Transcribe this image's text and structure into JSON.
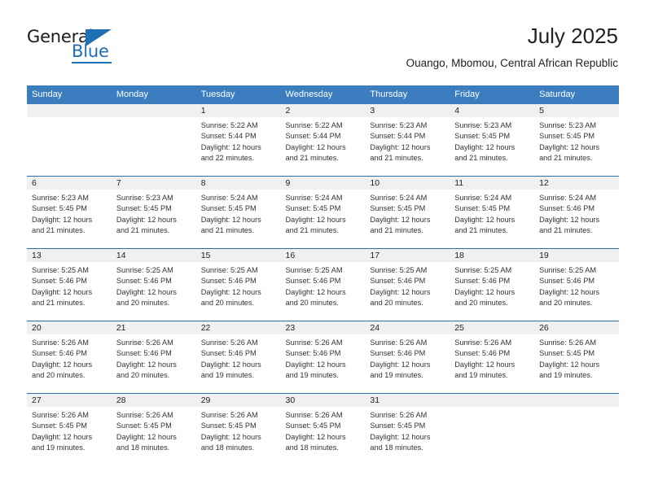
{
  "brand": {
    "name_part1": "General",
    "name_part2": "Blue",
    "accent_color": "#1f6fb5"
  },
  "header": {
    "month_title": "July 2025",
    "location": "Ouango, Mbomou, Central African Republic"
  },
  "calendar": {
    "header_bg": "#3b7dbf",
    "daynum_bg": "#f0f0f0",
    "row_divider": "#2f6ea5",
    "weekday_headers": [
      "Sunday",
      "Monday",
      "Tuesday",
      "Wednesday",
      "Thursday",
      "Friday",
      "Saturday"
    ],
    "weeks": [
      [
        {
          "day": "",
          "sunrise": "",
          "sunset": "",
          "daylight1": "",
          "daylight2": ""
        },
        {
          "day": "",
          "sunrise": "",
          "sunset": "",
          "daylight1": "",
          "daylight2": ""
        },
        {
          "day": "1",
          "sunrise": "Sunrise: 5:22 AM",
          "sunset": "Sunset: 5:44 PM",
          "daylight1": "Daylight: 12 hours",
          "daylight2": "and 22 minutes."
        },
        {
          "day": "2",
          "sunrise": "Sunrise: 5:22 AM",
          "sunset": "Sunset: 5:44 PM",
          "daylight1": "Daylight: 12 hours",
          "daylight2": "and 21 minutes."
        },
        {
          "day": "3",
          "sunrise": "Sunrise: 5:23 AM",
          "sunset": "Sunset: 5:44 PM",
          "daylight1": "Daylight: 12 hours",
          "daylight2": "and 21 minutes."
        },
        {
          "day": "4",
          "sunrise": "Sunrise: 5:23 AM",
          "sunset": "Sunset: 5:45 PM",
          "daylight1": "Daylight: 12 hours",
          "daylight2": "and 21 minutes."
        },
        {
          "day": "5",
          "sunrise": "Sunrise: 5:23 AM",
          "sunset": "Sunset: 5:45 PM",
          "daylight1": "Daylight: 12 hours",
          "daylight2": "and 21 minutes."
        }
      ],
      [
        {
          "day": "6",
          "sunrise": "Sunrise: 5:23 AM",
          "sunset": "Sunset: 5:45 PM",
          "daylight1": "Daylight: 12 hours",
          "daylight2": "and 21 minutes."
        },
        {
          "day": "7",
          "sunrise": "Sunrise: 5:23 AM",
          "sunset": "Sunset: 5:45 PM",
          "daylight1": "Daylight: 12 hours",
          "daylight2": "and 21 minutes."
        },
        {
          "day": "8",
          "sunrise": "Sunrise: 5:24 AM",
          "sunset": "Sunset: 5:45 PM",
          "daylight1": "Daylight: 12 hours",
          "daylight2": "and 21 minutes."
        },
        {
          "day": "9",
          "sunrise": "Sunrise: 5:24 AM",
          "sunset": "Sunset: 5:45 PM",
          "daylight1": "Daylight: 12 hours",
          "daylight2": "and 21 minutes."
        },
        {
          "day": "10",
          "sunrise": "Sunrise: 5:24 AM",
          "sunset": "Sunset: 5:45 PM",
          "daylight1": "Daylight: 12 hours",
          "daylight2": "and 21 minutes."
        },
        {
          "day": "11",
          "sunrise": "Sunrise: 5:24 AM",
          "sunset": "Sunset: 5:45 PM",
          "daylight1": "Daylight: 12 hours",
          "daylight2": "and 21 minutes."
        },
        {
          "day": "12",
          "sunrise": "Sunrise: 5:24 AM",
          "sunset": "Sunset: 5:46 PM",
          "daylight1": "Daylight: 12 hours",
          "daylight2": "and 21 minutes."
        }
      ],
      [
        {
          "day": "13",
          "sunrise": "Sunrise: 5:25 AM",
          "sunset": "Sunset: 5:46 PM",
          "daylight1": "Daylight: 12 hours",
          "daylight2": "and 21 minutes."
        },
        {
          "day": "14",
          "sunrise": "Sunrise: 5:25 AM",
          "sunset": "Sunset: 5:46 PM",
          "daylight1": "Daylight: 12 hours",
          "daylight2": "and 20 minutes."
        },
        {
          "day": "15",
          "sunrise": "Sunrise: 5:25 AM",
          "sunset": "Sunset: 5:46 PM",
          "daylight1": "Daylight: 12 hours",
          "daylight2": "and 20 minutes."
        },
        {
          "day": "16",
          "sunrise": "Sunrise: 5:25 AM",
          "sunset": "Sunset: 5:46 PM",
          "daylight1": "Daylight: 12 hours",
          "daylight2": "and 20 minutes."
        },
        {
          "day": "17",
          "sunrise": "Sunrise: 5:25 AM",
          "sunset": "Sunset: 5:46 PM",
          "daylight1": "Daylight: 12 hours",
          "daylight2": "and 20 minutes."
        },
        {
          "day": "18",
          "sunrise": "Sunrise: 5:25 AM",
          "sunset": "Sunset: 5:46 PM",
          "daylight1": "Daylight: 12 hours",
          "daylight2": "and 20 minutes."
        },
        {
          "day": "19",
          "sunrise": "Sunrise: 5:25 AM",
          "sunset": "Sunset: 5:46 PM",
          "daylight1": "Daylight: 12 hours",
          "daylight2": "and 20 minutes."
        }
      ],
      [
        {
          "day": "20",
          "sunrise": "Sunrise: 5:26 AM",
          "sunset": "Sunset: 5:46 PM",
          "daylight1": "Daylight: 12 hours",
          "daylight2": "and 20 minutes."
        },
        {
          "day": "21",
          "sunrise": "Sunrise: 5:26 AM",
          "sunset": "Sunset: 5:46 PM",
          "daylight1": "Daylight: 12 hours",
          "daylight2": "and 20 minutes."
        },
        {
          "day": "22",
          "sunrise": "Sunrise: 5:26 AM",
          "sunset": "Sunset: 5:46 PM",
          "daylight1": "Daylight: 12 hours",
          "daylight2": "and 19 minutes."
        },
        {
          "day": "23",
          "sunrise": "Sunrise: 5:26 AM",
          "sunset": "Sunset: 5:46 PM",
          "daylight1": "Daylight: 12 hours",
          "daylight2": "and 19 minutes."
        },
        {
          "day": "24",
          "sunrise": "Sunrise: 5:26 AM",
          "sunset": "Sunset: 5:46 PM",
          "daylight1": "Daylight: 12 hours",
          "daylight2": "and 19 minutes."
        },
        {
          "day": "25",
          "sunrise": "Sunrise: 5:26 AM",
          "sunset": "Sunset: 5:46 PM",
          "daylight1": "Daylight: 12 hours",
          "daylight2": "and 19 minutes."
        },
        {
          "day": "26",
          "sunrise": "Sunrise: 5:26 AM",
          "sunset": "Sunset: 5:45 PM",
          "daylight1": "Daylight: 12 hours",
          "daylight2": "and 19 minutes."
        }
      ],
      [
        {
          "day": "27",
          "sunrise": "Sunrise: 5:26 AM",
          "sunset": "Sunset: 5:45 PM",
          "daylight1": "Daylight: 12 hours",
          "daylight2": "and 19 minutes."
        },
        {
          "day": "28",
          "sunrise": "Sunrise: 5:26 AM",
          "sunset": "Sunset: 5:45 PM",
          "daylight1": "Daylight: 12 hours",
          "daylight2": "and 18 minutes."
        },
        {
          "day": "29",
          "sunrise": "Sunrise: 5:26 AM",
          "sunset": "Sunset: 5:45 PM",
          "daylight1": "Daylight: 12 hours",
          "daylight2": "and 18 minutes."
        },
        {
          "day": "30",
          "sunrise": "Sunrise: 5:26 AM",
          "sunset": "Sunset: 5:45 PM",
          "daylight1": "Daylight: 12 hours",
          "daylight2": "and 18 minutes."
        },
        {
          "day": "31",
          "sunrise": "Sunrise: 5:26 AM",
          "sunset": "Sunset: 5:45 PM",
          "daylight1": "Daylight: 12 hours",
          "daylight2": "and 18 minutes."
        },
        {
          "day": "",
          "sunrise": "",
          "sunset": "",
          "daylight1": "",
          "daylight2": ""
        },
        {
          "day": "",
          "sunrise": "",
          "sunset": "",
          "daylight1": "",
          "daylight2": ""
        }
      ]
    ]
  }
}
